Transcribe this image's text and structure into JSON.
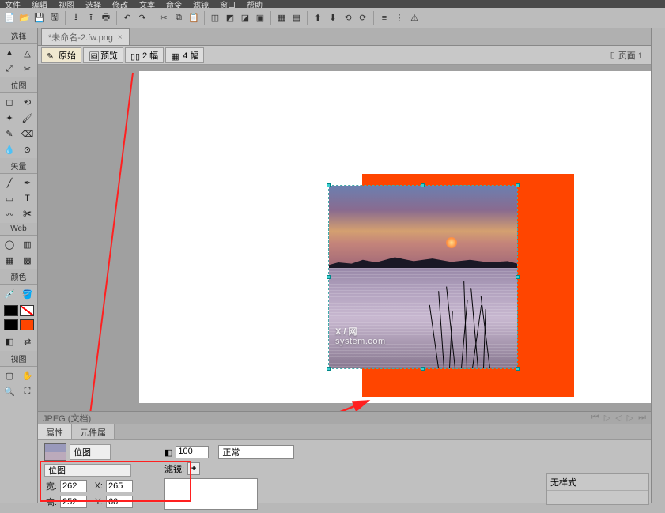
{
  "menu": {
    "items": [
      "文件",
      "编辑",
      "视图",
      "选择",
      "修改",
      "文本",
      "命令",
      "滤镜",
      "窗口",
      "帮助"
    ]
  },
  "doc": {
    "title": "*未命名-2.fw.png"
  },
  "view_modes": {
    "original": "原始",
    "preview": "预览",
    "two_up": "2 幅",
    "four_up": "4 幅"
  },
  "page_indicator": "页面 1",
  "status": {
    "format": "JPEG (文档)"
  },
  "tool_panel": {
    "select_title": "选择",
    "bitmap_title": "位图",
    "vector_title": "矢量",
    "web_title": "Web",
    "color_title": "颜色",
    "view_title": "视图"
  },
  "watermark": {
    "big": "X / 网",
    "small": "system.com"
  },
  "bottom_tabs": {
    "props": "属性",
    "symbol": "元件属"
  },
  "props": {
    "kind_label": "位图",
    "name_value": "位图",
    "w_label": "宽:",
    "w_value": "262",
    "x_label": "X:",
    "x_value": "265",
    "h_label": "高:",
    "h_value": "252",
    "y_label": "Y:",
    "y_value": "60",
    "opacity_icon": "◧",
    "opacity_value": "100",
    "blend_label": "正常",
    "filter_label": "滤镜:",
    "filter_add": "+"
  },
  "style_panel": {
    "title": "无样式"
  }
}
